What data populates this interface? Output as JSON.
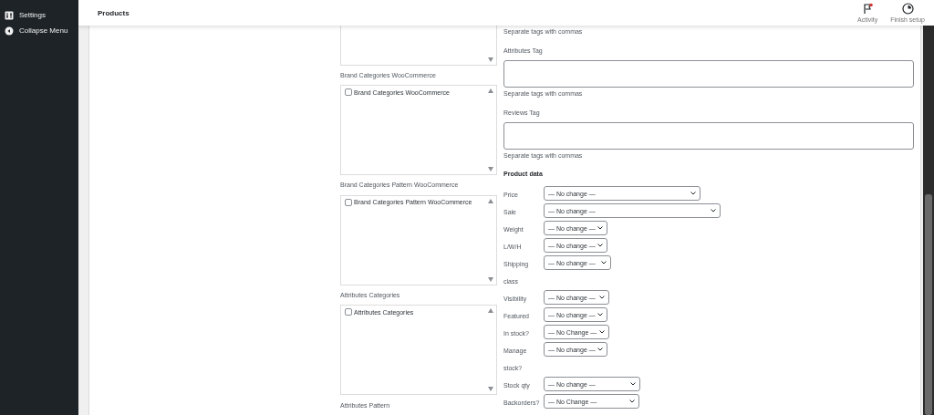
{
  "sidebar": {
    "items": [
      {
        "label": "Settings"
      },
      {
        "label": "Collapse Menu"
      }
    ]
  },
  "header": {
    "title": "Products",
    "actions": [
      {
        "label": "Activity"
      },
      {
        "label": "Finish setup"
      }
    ]
  },
  "categories": [
    {
      "label": "Brand Categories WooCommerce",
      "items": [
        {
          "label": "Brand Categories WooCommerce",
          "checked": false
        }
      ]
    },
    {
      "label": "Brand Categories Pattern WooCommerce",
      "items": [
        {
          "label": "Brand Categories Pattern WooCommerce",
          "checked": false
        }
      ]
    },
    {
      "label": "Attributes Categories",
      "items": [
        {
          "label": "Attributes Categories",
          "checked": false
        }
      ]
    }
  ],
  "next_category_label": "Attributes Pattern",
  "top_hint": "Separate tags with commas",
  "tag_fields": [
    {
      "label": "Attributes Tag",
      "hint": "Separate tags with commas"
    },
    {
      "label": "Reviews Tag",
      "hint": "Separate tags with commas"
    }
  ],
  "product_data": {
    "title": "Product data",
    "fields": [
      {
        "label": "Price",
        "value": "— No change —"
      },
      {
        "label": "Sale",
        "value": "— No change —"
      },
      {
        "label": "Weight",
        "value": "— No change —"
      },
      {
        "label": "L/W/H",
        "value": "— No change —"
      },
      {
        "label": "Shipping class",
        "value": "— No change —"
      },
      {
        "label": "Visibility",
        "value": "— No change —"
      },
      {
        "label": "Featured",
        "value": "— No change —"
      },
      {
        "label": "In stock?",
        "value": "— No Change —"
      },
      {
        "label": "Manage stock?",
        "value": "— No change —"
      },
      {
        "label": "Stock qty",
        "value": "— No change —"
      },
      {
        "label": "Backorders?",
        "value": "— No Change —"
      }
    ]
  }
}
